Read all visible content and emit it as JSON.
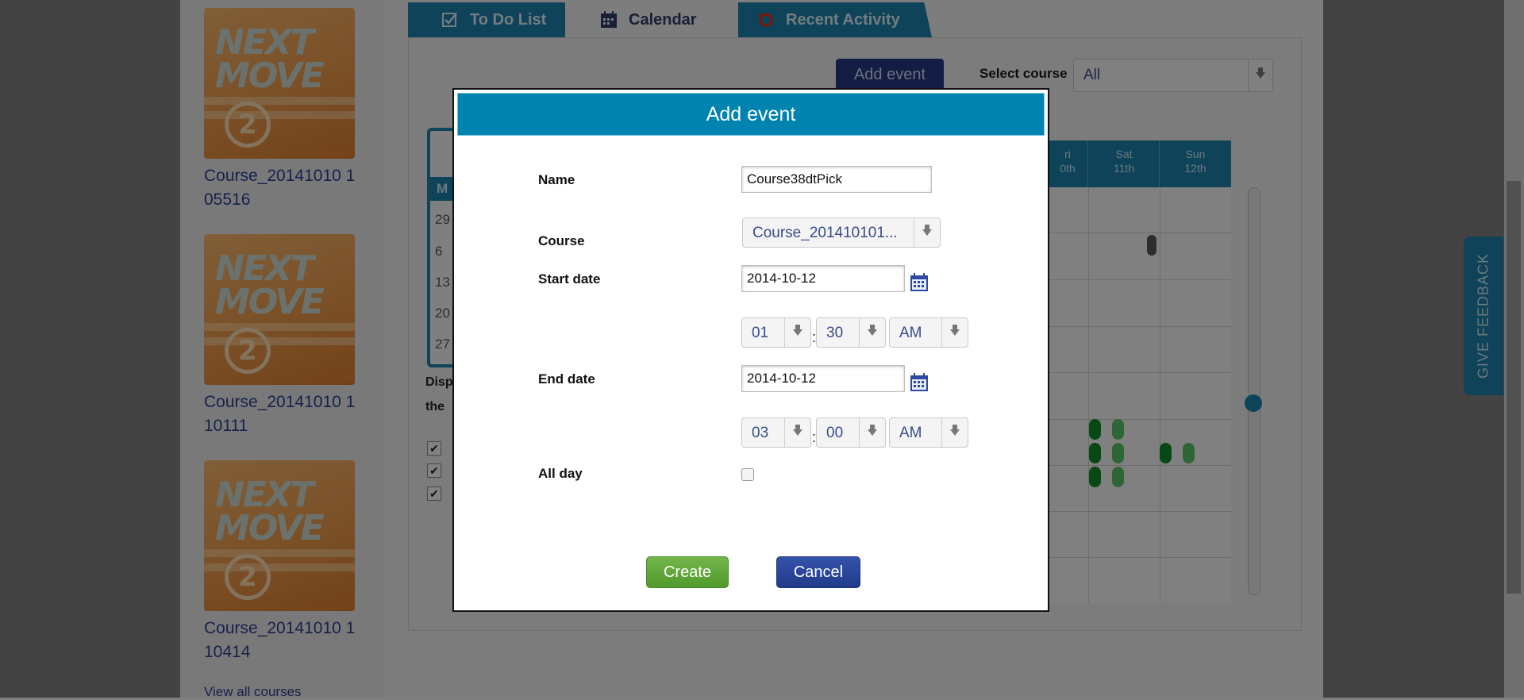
{
  "courses": [
    {
      "thumb_line1": "NEXT",
      "thumb_line2": "MOVE",
      "thumb_num": "2",
      "name": "Course_20141010 105516"
    },
    {
      "thumb_line1": "NEXT",
      "thumb_line2": "MOVE",
      "thumb_num": "2",
      "name": "Course_20141010 110111"
    },
    {
      "thumb_line1": "NEXT",
      "thumb_line2": "MOVE",
      "thumb_num": "2",
      "name": "Course_20141010 110414"
    }
  ],
  "view_all_label": "View all courses",
  "tabs": [
    {
      "label": "To Do List",
      "icon": "checkbox-icon"
    },
    {
      "label": "Calendar",
      "icon": "calendar-icon"
    },
    {
      "label": "Recent Activity",
      "icon": "refresh-icon"
    }
  ],
  "toolbar": {
    "add_event_label": "Add event",
    "select_course_label": "Select course",
    "select_course_value": "All"
  },
  "calendar": {
    "day_headers": [
      {
        "day": "ri",
        "date": "0th"
      },
      {
        "day": "Sat",
        "date": "11th"
      },
      {
        "day": "Sun",
        "date": "12th"
      }
    ],
    "mini_header": "M",
    "mini_days": [
      "29",
      "6",
      "13",
      "20",
      "27"
    ],
    "display_text_1": "Disp",
    "display_text_2": "the"
  },
  "feedback_label": "GIVE FEEDBACK",
  "modal": {
    "title": "Add event",
    "name_label": "Name",
    "name_value": "Course38dtPick",
    "course_label": "Course",
    "course_value": "Course_201410101...",
    "start_date_label": "Start date",
    "start_date_value": "2014-10-12",
    "start_hour": "01",
    "start_minute": "30",
    "start_ampm": "AM",
    "end_date_label": "End date",
    "end_date_value": "2014-10-12",
    "end_hour": "03",
    "end_minute": "00",
    "end_ampm": "AM",
    "time_separator": ":",
    "all_day_label": "All day",
    "all_day_checked": false,
    "create_label": "Create",
    "cancel_label": "Cancel"
  },
  "colors": {
    "modal_header": "#0183b0",
    "create_button": "#5fa83a",
    "cancel_button": "#2a45a0",
    "tab_blue": "#1b7fa8",
    "event_dark": "#0d8a27",
    "event_light": "#58c06a"
  }
}
